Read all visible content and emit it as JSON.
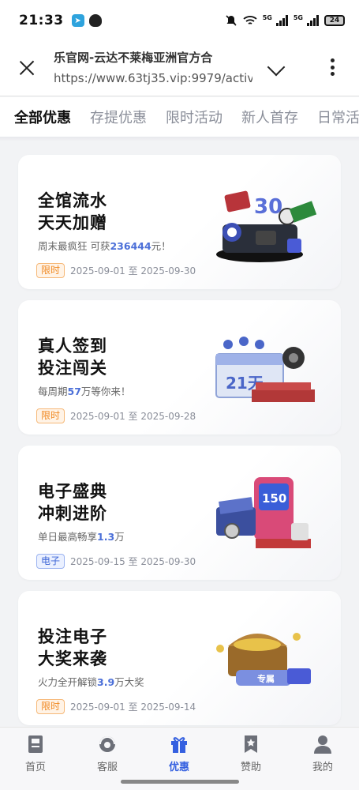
{
  "status_bar": {
    "time": "21:33",
    "network_label_1": "5G",
    "network_label_2": "5G",
    "battery": "24"
  },
  "browser": {
    "title": "乐官网-云达不莱梅亚洲官方合",
    "url": "https://www.63tj35.vip:9979/activi"
  },
  "tabs": [
    {
      "label": "全部优惠",
      "active": true
    },
    {
      "label": "存提优惠",
      "active": false
    },
    {
      "label": "限时活动",
      "active": false
    },
    {
      "label": "新人首存",
      "active": false
    },
    {
      "label": "日常活",
      "active": false
    }
  ],
  "promos": [
    {
      "title_line1": "全馆流水",
      "title_line2": "天天加赠",
      "sub_prefix": "周末最疯狂 可获",
      "sub_highlight": "236444",
      "sub_suffix": "元！",
      "badge": "限时",
      "badge_style": "orange",
      "dates": "2025-09-01 至 2025-09-30",
      "art_text": "30"
    },
    {
      "title_line1": "真人签到",
      "title_line2": "投注闯关",
      "sub_prefix": "每周期",
      "sub_highlight": "57",
      "sub_suffix": "万等你来！",
      "badge": "限时",
      "badge_style": "orange",
      "dates": "2025-09-01 至 2025-09-28",
      "art_text": "21天"
    },
    {
      "title_line1": "电子盛典",
      "title_line2": "冲刺进阶",
      "sub_prefix": "单日最高畅享",
      "sub_highlight": "1.3",
      "sub_suffix": "万",
      "badge": "电子",
      "badge_style": "blue",
      "dates": "2025-09-15 至 2025-09-30",
      "art_text": "150"
    },
    {
      "title_line1": "投注电子",
      "title_line2": "大奖来袭",
      "sub_prefix": "火力全开解锁",
      "sub_highlight": "3.9",
      "sub_suffix": "万大奖",
      "badge": "限时",
      "badge_style": "orange",
      "dates": "2025-09-01 至 2025-09-14",
      "art_text": "专属"
    }
  ],
  "bottom_nav": [
    {
      "label": "首页",
      "icon": "home-doc-icon",
      "active": false
    },
    {
      "label": "客服",
      "icon": "headset-icon",
      "active": false
    },
    {
      "label": "优惠",
      "icon": "gift-icon",
      "active": true
    },
    {
      "label": "赞助",
      "icon": "star-bookmark-icon",
      "active": false
    },
    {
      "label": "我的",
      "icon": "user-icon",
      "active": false
    }
  ],
  "colors": {
    "accent_blue": "#3560e0",
    "highlight_blue": "#4b6fd8",
    "badge_orange": "#f08a24"
  }
}
